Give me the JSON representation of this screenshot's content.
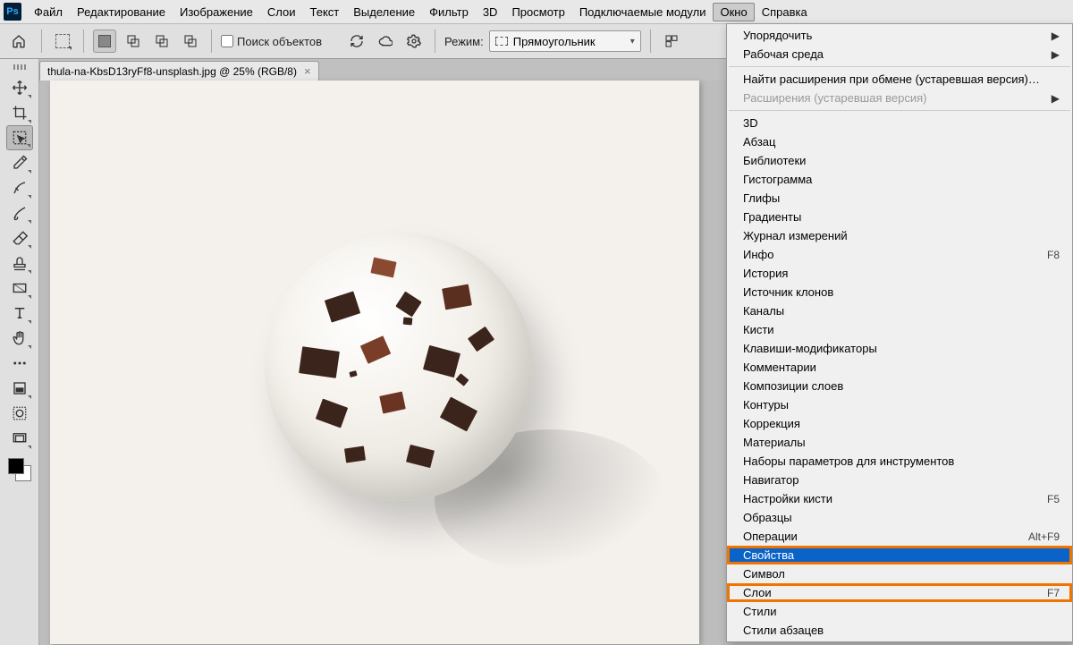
{
  "menubar": {
    "items": [
      "Файл",
      "Редактирование",
      "Изображение",
      "Слои",
      "Текст",
      "Выделение",
      "Фильтр",
      "3D",
      "Просмотр",
      "Подключаемые модули",
      "Окно",
      "Справка"
    ],
    "active_index": 10
  },
  "optionsbar": {
    "search_label": "Поиск объектов",
    "mode_label": "Режим:",
    "mode_value": "Прямоугольник"
  },
  "document": {
    "tab_title": "thula-na-KbsD13ryFf8-unsplash.jpg @ 25% (RGB/8)"
  },
  "dropdown": {
    "items": [
      {
        "label": "Упорядочить",
        "submenu": true
      },
      {
        "label": "Рабочая среда",
        "submenu": true
      },
      {
        "sep": true
      },
      {
        "label": "Найти расширения при обмене (устаревшая версия)…"
      },
      {
        "label": "Расширения (устаревшая версия)",
        "submenu": true,
        "disabled": true
      },
      {
        "sep": true
      },
      {
        "label": "3D"
      },
      {
        "label": "Абзац"
      },
      {
        "label": "Библиотеки"
      },
      {
        "label": "Гистограмма"
      },
      {
        "label": "Глифы"
      },
      {
        "label": "Градиенты"
      },
      {
        "label": "Журнал измерений"
      },
      {
        "label": "Инфо",
        "shortcut": "F8"
      },
      {
        "label": "История"
      },
      {
        "label": "Источник клонов"
      },
      {
        "label": "Каналы"
      },
      {
        "label": "Кисти"
      },
      {
        "label": "Клавиши-модификаторы"
      },
      {
        "label": "Комментарии"
      },
      {
        "label": "Композиции слоев"
      },
      {
        "label": "Контуры"
      },
      {
        "label": "Коррекция"
      },
      {
        "label": "Материалы"
      },
      {
        "label": "Наборы параметров для инструментов"
      },
      {
        "label": "Навигатор"
      },
      {
        "label": "Настройки кисти",
        "shortcut": "F5"
      },
      {
        "label": "Образцы"
      },
      {
        "label": "Операции",
        "shortcut": "Alt+F9"
      },
      {
        "label": "Свойства",
        "hl": "blue-orange"
      },
      {
        "label": "Символ"
      },
      {
        "label": "Слои",
        "shortcut": "F7",
        "hl": "orange"
      },
      {
        "label": "Стили"
      },
      {
        "label": "Стили абзацев"
      }
    ]
  },
  "toolbar": {
    "tools": [
      {
        "name": "move-tool",
        "dd": true
      },
      {
        "name": "crop-tool",
        "dd": true
      },
      {
        "name": "object-select-tool",
        "sel": true,
        "dd": true
      },
      {
        "name": "eyedropper-tool",
        "dd": true
      },
      {
        "name": "healing-brush-tool",
        "dd": true
      },
      {
        "name": "brush-tool",
        "dd": true
      },
      {
        "name": "eraser-tool",
        "dd": true
      },
      {
        "name": "stamp-tool",
        "dd": true
      },
      {
        "name": "gradient-tool",
        "dd": true
      },
      {
        "name": "type-tool",
        "dd": true
      },
      {
        "name": "hand-tool",
        "dd": true
      },
      {
        "name": "more-tools",
        "dd": false
      },
      {
        "name": "edit-toolbar",
        "dd": true
      },
      {
        "name": "quickmask-tool",
        "dd": false
      },
      {
        "name": "screenmode-tool",
        "dd": true
      }
    ]
  }
}
